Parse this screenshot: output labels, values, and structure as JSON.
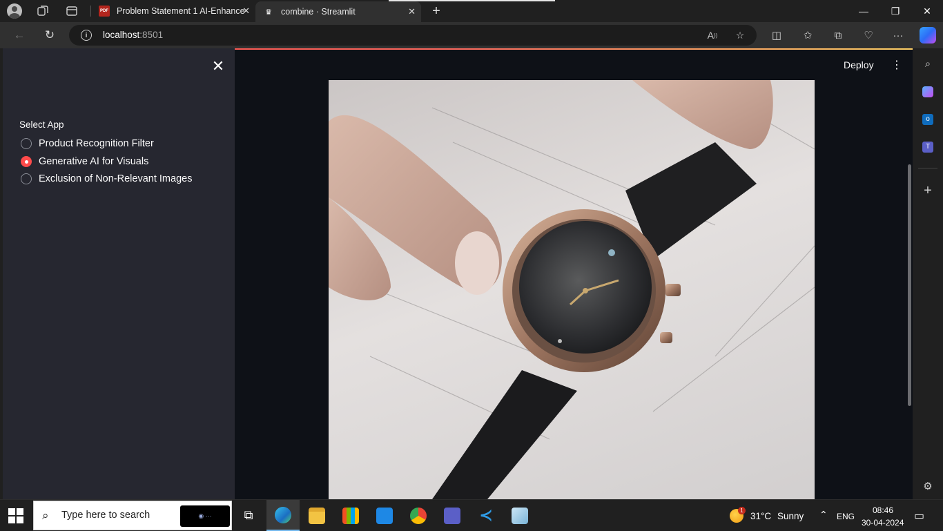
{
  "browser": {
    "tabs": [
      {
        "title": "Problem Statement 1 AI-Enhance",
        "favicon": "pdf-icon",
        "active": false
      },
      {
        "title": "combine · Streamlit",
        "favicon": "streamlit-crown-icon",
        "active": true
      }
    ],
    "address": {
      "host": "localhost",
      "port": ":8501"
    }
  },
  "app": {
    "sidebar": {
      "label": "Select App",
      "options": [
        {
          "label": "Product Recognition Filter",
          "selected": false
        },
        {
          "label": "Generative AI for Visuals",
          "selected": true
        },
        {
          "label": "Exclusion of Non-Relevant Images",
          "selected": false
        }
      ]
    },
    "header": {
      "deploy_label": "Deploy"
    },
    "accent_color": "#ff4b4b"
  },
  "taskbar": {
    "search_placeholder": "Type here to search",
    "weather": {
      "temp": "31°C",
      "condition": "Sunny",
      "badge": "1"
    },
    "lang": "ENG",
    "time": "08:46",
    "date": "30-04-2024"
  }
}
